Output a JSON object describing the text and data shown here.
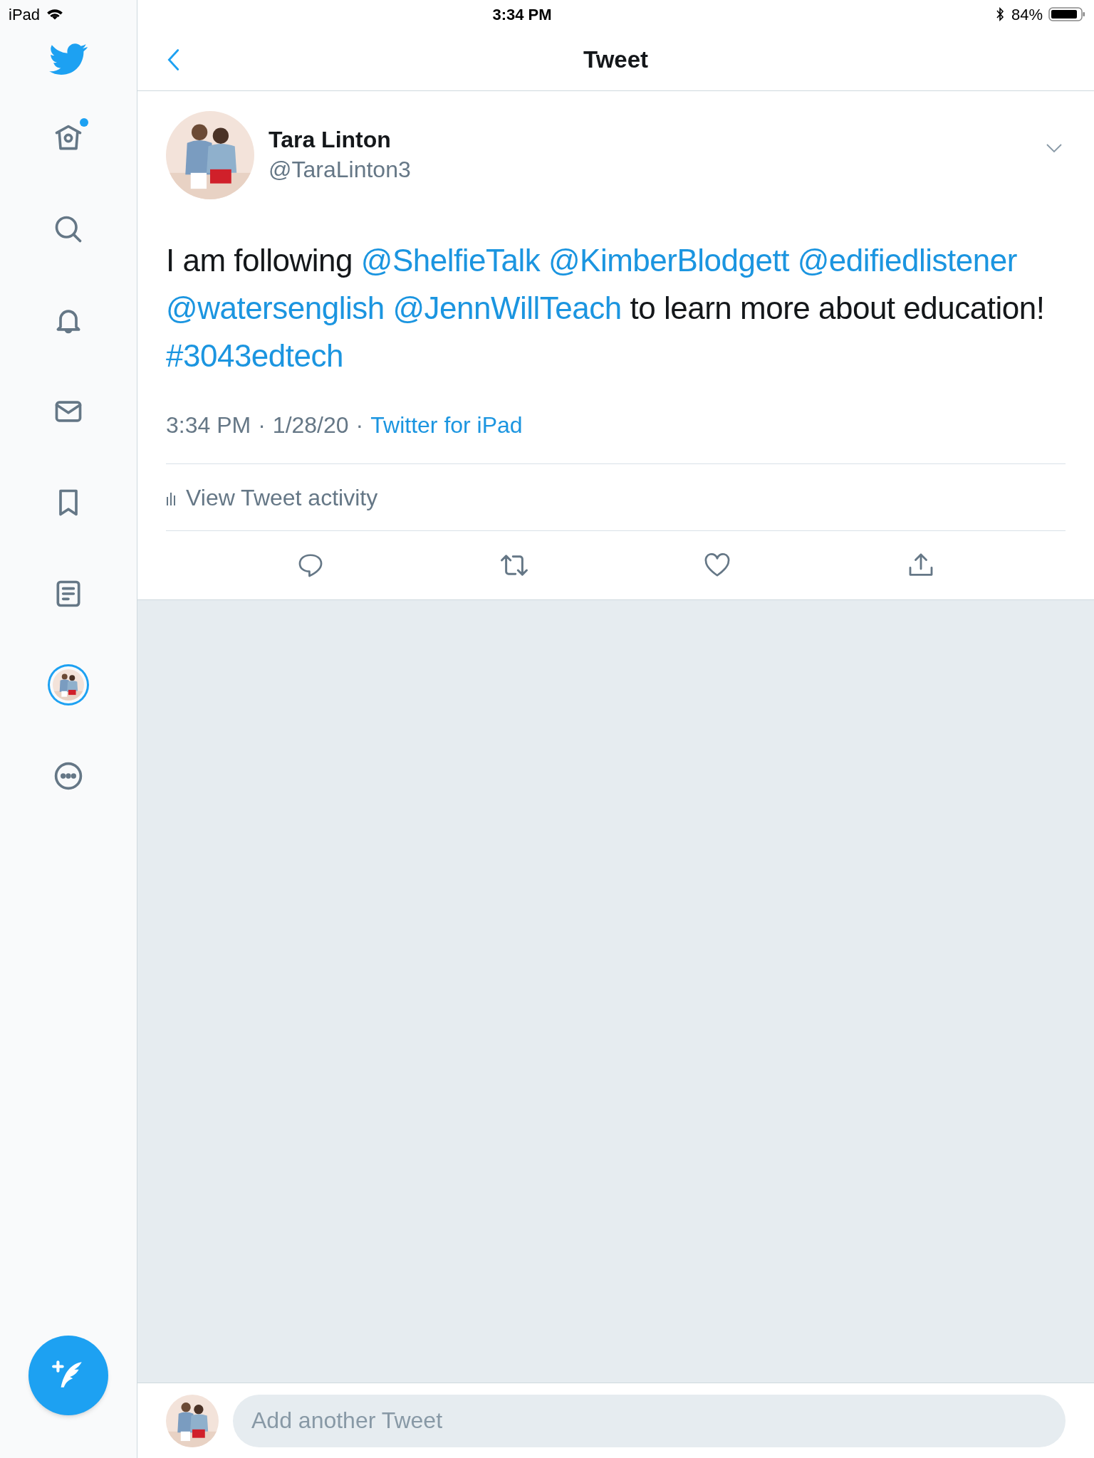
{
  "status_bar": {
    "device": "iPad",
    "time": "3:34 PM",
    "battery": "84%"
  },
  "sidebar": {
    "items": [
      {
        "kind": "home",
        "badge": true,
        "selected": false
      },
      {
        "kind": "search",
        "badge": false,
        "selected": false
      },
      {
        "kind": "notifications",
        "badge": false,
        "selected": false
      },
      {
        "kind": "messages",
        "badge": false,
        "selected": false
      },
      {
        "kind": "bookmarks",
        "badge": false,
        "selected": false
      },
      {
        "kind": "lists",
        "badge": false,
        "selected": false
      },
      {
        "kind": "profile",
        "badge": false,
        "selected": true
      },
      {
        "kind": "more",
        "badge": false,
        "selected": false
      }
    ]
  },
  "header": {
    "title": "Tweet"
  },
  "tweet": {
    "name": "Tara Linton",
    "handle": "@TaraLinton3",
    "text": [
      {
        "kind": "text",
        "text": "I am following "
      },
      {
        "kind": "link",
        "text": "@ShelfieTalk"
      },
      {
        "kind": "link",
        "text": "@KimberBlodgett"
      },
      {
        "kind": "link",
        "text": "@edifiedlistener"
      },
      {
        "kind": "link",
        "text": "@watersenglish"
      },
      {
        "kind": "link",
        "text": "@JennWillTeach"
      },
      {
        "kind": "text",
        "text": " to learn more about education! "
      },
      {
        "kind": "link",
        "text": "#3043edtech"
      }
    ],
    "time": "3:34 PM",
    "separator": "·",
    "date": "1/28/20",
    "source": "Twitter for iPad",
    "activity": "View Tweet activity"
  },
  "composer": {
    "placeholder": "Add another Tweet"
  }
}
